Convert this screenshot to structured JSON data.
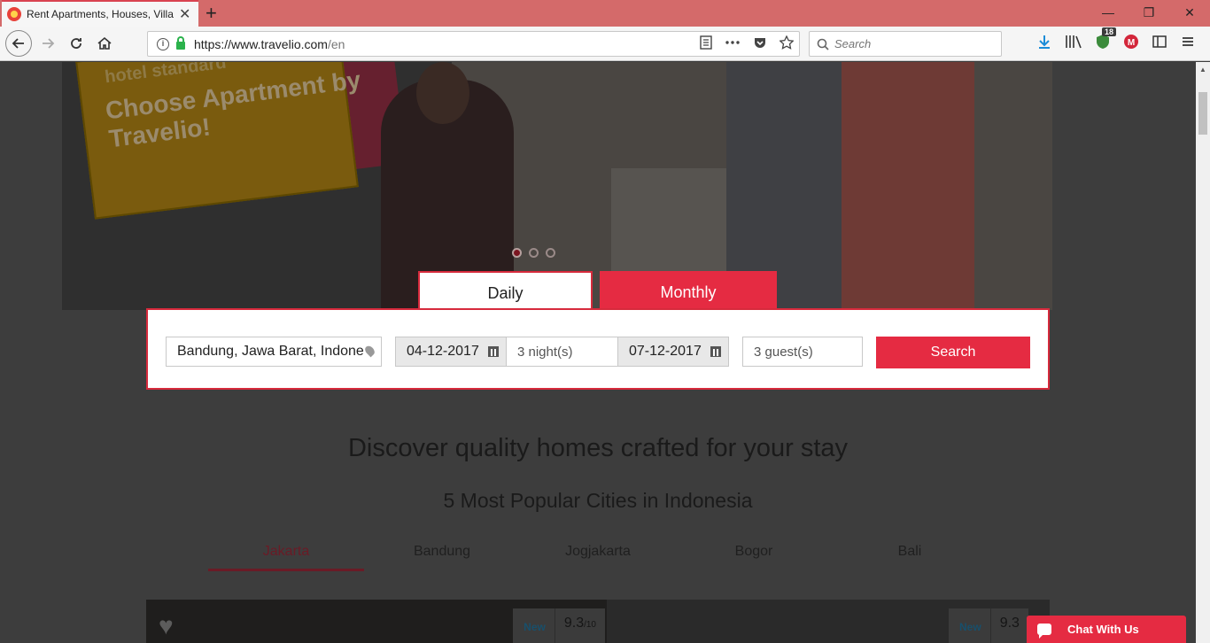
{
  "browser": {
    "tab_title": "Rent Apartments, Houses, Villas",
    "tab_close": "✕",
    "new_tab": "+",
    "url_domain": "https://www.travelio.com",
    "url_path": "/en",
    "search_placeholder": "Search",
    "badge_count": "18",
    "window_controls": [
      "—",
      "❐",
      "✕"
    ]
  },
  "hero": {
    "promo_small": "hotel standard",
    "promo_text": "Choose Apartment by Travelio!"
  },
  "booking": {
    "tabs": [
      "Daily",
      "Monthly"
    ],
    "location": "Bandung, Jawa Barat, Indone",
    "check_in": "04-12-2017",
    "nights": "3 night(s)",
    "check_out": "07-12-2017",
    "guests": "3 guest(s)",
    "search_label": "Search"
  },
  "content": {
    "headline": "Discover quality homes crafted for your stay",
    "subhead": "5 Most Popular Cities in Indonesia",
    "cities": [
      "Jakarta",
      "Bandung",
      "Jogjakarta",
      "Bogor",
      "Bali"
    ],
    "active_city": "Jakarta"
  },
  "cards": [
    {
      "badge": "New",
      "score": "9.3",
      "score_max": "/10"
    },
    {
      "badge": "New",
      "score": "9.3",
      "score_max": ""
    }
  ],
  "chat": {
    "label": "Chat With Us"
  }
}
